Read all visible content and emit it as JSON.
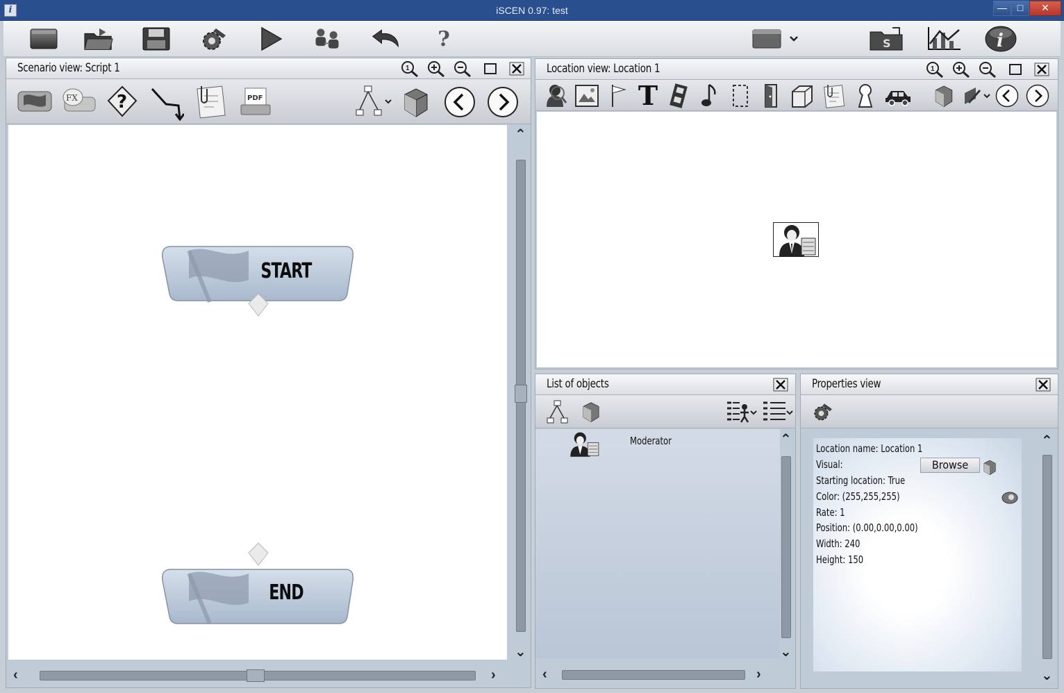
{
  "window": {
    "title": "iSCEN  0.97: test",
    "app_icon_letter": "i",
    "minimize": "—",
    "maximize": "□",
    "close": "✕"
  },
  "toolbar": {
    "icons": [
      "new-document-icon",
      "open-folder-icon",
      "save-icon",
      "settings-gear-icon",
      "play-icon",
      "users-icon",
      "undo-icon",
      "help-icon",
      "window-dropdown-icon",
      "export-icon",
      "statistics-chart-icon",
      "info-icon"
    ],
    "help_glyph": "?",
    "info_glyph": "i"
  },
  "scenario": {
    "title": "Scenario view: Script 1",
    "fx_label": "FX",
    "pdf_label": "PDF",
    "nodes": [
      {
        "label": "START"
      },
      {
        "label": "END"
      }
    ]
  },
  "location": {
    "title": "Location view: Location 1",
    "text_tool": "T"
  },
  "objects": {
    "title": "List of objects",
    "items": [
      {
        "name": "Moderator"
      }
    ]
  },
  "properties": {
    "title": "Properties view",
    "location_name": "Location name: Location 1",
    "visual": "Visual:",
    "browse": "Browse",
    "starting_location": "Starting location: True",
    "color": "Color: (255,255,255)",
    "rate": "Rate:  1",
    "position": "Position: (0.00,0.00,0.00)",
    "width": "Width: 240",
    "height": "Height: 150"
  },
  "colors": {
    "titlebar": "#2a4f8f",
    "panel_bg": "#c0cbd8",
    "node_fill": "#b5c3d5"
  }
}
